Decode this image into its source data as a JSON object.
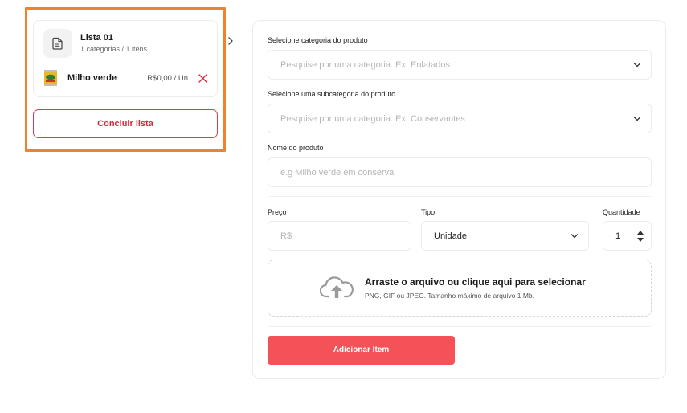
{
  "list": {
    "title": "Lista 01",
    "subtitle": "1 categorias / 1 itens",
    "items": [
      {
        "name": "Milho verde",
        "price": "R$0,00 / Un"
      }
    ],
    "conclude_label": "Concluir lista"
  },
  "form": {
    "category": {
      "label": "Selecione categoria do produto",
      "placeholder": "Pesquise por uma categoria. Ex. Enlatados"
    },
    "subcategory": {
      "label": "Selecione uma subcategoria do produto",
      "placeholder": "Pesquise por uma categoria. Ex. Conservantes"
    },
    "product_name": {
      "label": "Nome do produto",
      "placeholder": "e.g Milho verde em conserva"
    },
    "price": {
      "label": "Preço",
      "placeholder": "R$"
    },
    "type": {
      "label": "Tipo",
      "value": "Unidade"
    },
    "quantity": {
      "label": "Quantidade",
      "value": "1"
    },
    "upload": {
      "title": "Arraste o arquivo ou clique aqui para selecionar",
      "subtitle": "PNG, GIF ou JPEG. Tamanho máximo de arquivo 1 Mb."
    },
    "add_label": "Adicionar Item"
  },
  "colors": {
    "highlight_border": "#f0832a",
    "danger": "#e0273d",
    "primary_button": "#f45158"
  },
  "icons": {
    "list": "document-icon",
    "remove": "close-icon",
    "expand": "chevron-right-icon",
    "dropdown": "chevron-down-icon",
    "upload": "cloud-upload-icon",
    "stepper": "spinner-arrows-icon"
  }
}
